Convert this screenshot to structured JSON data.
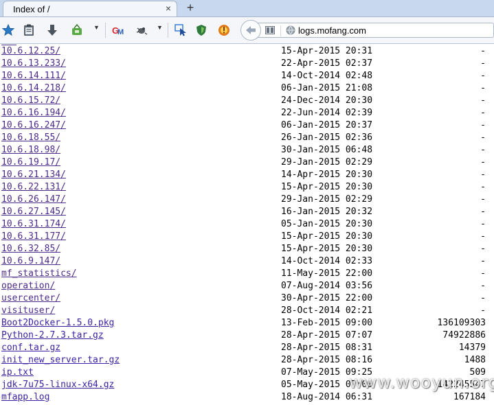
{
  "tab": {
    "title": "Index of /",
    "close": "×",
    "new_tab": "+"
  },
  "toolbar": {
    "icons": [
      "star-icon",
      "clipboard-icon",
      "download-arrow-icon",
      "basket-icon",
      "gm-icon",
      "bug-icon",
      "cursor-icon",
      "shield-icon",
      "addon-icon"
    ]
  },
  "url": {
    "text": "logs.mofang.com"
  },
  "listing": {
    "rows": [
      {
        "name": "10.6.12.25/",
        "date": "15-Apr-2015 20:31",
        "size": "-",
        "dir": true
      },
      {
        "name": "10.6.13.233/",
        "date": "22-Apr-2015 02:37",
        "size": "-",
        "dir": true
      },
      {
        "name": "10.6.14.111/",
        "date": "14-Oct-2014 02:48",
        "size": "-",
        "dir": true
      },
      {
        "name": "10.6.14.218/",
        "date": "06-Jan-2015 21:08",
        "size": "-",
        "dir": true
      },
      {
        "name": "10.6.15.72/",
        "date": "24-Dec-2014 20:30",
        "size": "-",
        "dir": true
      },
      {
        "name": "10.6.16.194/",
        "date": "22-Jun-2014 02:39",
        "size": "-",
        "dir": true
      },
      {
        "name": "10.6.16.247/",
        "date": "06-Jan-2015 20:37",
        "size": "-",
        "dir": true
      },
      {
        "name": "10.6.18.55/",
        "date": "26-Jan-2015 02:36",
        "size": "-",
        "dir": true
      },
      {
        "name": "10.6.18.98/",
        "date": "30-Jan-2015 06:48",
        "size": "-",
        "dir": true
      },
      {
        "name": "10.6.19.17/",
        "date": "29-Jan-2015 02:29",
        "size": "-",
        "dir": true
      },
      {
        "name": "10.6.21.134/",
        "date": "14-Apr-2015 20:30",
        "size": "-",
        "dir": true
      },
      {
        "name": "10.6.22.131/",
        "date": "15-Apr-2015 20:30",
        "size": "-",
        "dir": true
      },
      {
        "name": "10.6.26.147/",
        "date": "29-Jan-2015 02:29",
        "size": "-",
        "dir": true
      },
      {
        "name": "10.6.27.145/",
        "date": "16-Jan-2015 20:32",
        "size": "-",
        "dir": true
      },
      {
        "name": "10.6.31.174/",
        "date": "05-Jan-2015 20:30",
        "size": "-",
        "dir": true
      },
      {
        "name": "10.6.31.177/",
        "date": "15-Apr-2015 20:30",
        "size": "-",
        "dir": true
      },
      {
        "name": "10.6.32.85/",
        "date": "15-Apr-2015 20:30",
        "size": "-",
        "dir": true
      },
      {
        "name": "10.6.9.147/",
        "date": "14-Oct-2014 02:33",
        "size": "-",
        "dir": true
      },
      {
        "name": "mf_statistics/",
        "date": "11-May-2015 22:00",
        "size": "-",
        "dir": true
      },
      {
        "name": "operation/",
        "date": "07-Aug-2014 03:56",
        "size": "-",
        "dir": true
      },
      {
        "name": "usercenter/",
        "date": "30-Apr-2015 22:00",
        "size": "-",
        "dir": true
      },
      {
        "name": "visituser/",
        "date": "28-Oct-2014 02:21",
        "size": "-",
        "dir": true
      },
      {
        "name": "Boot2Docker-1.5.0.pkg",
        "date": "13-Feb-2015 09:00",
        "size": "136109303",
        "dir": false
      },
      {
        "name": "Python-2.7.3.tar.gz",
        "date": "28-Apr-2015 07:07",
        "size": "74922886",
        "dir": false
      },
      {
        "name": "conf.tar.gz",
        "date": "28-Apr-2015 08:31",
        "size": "14379",
        "dir": false
      },
      {
        "name": "init_new_server.tar.gz",
        "date": "28-Apr-2015 08:16",
        "size": "1488",
        "dir": false
      },
      {
        "name": "ip.txt",
        "date": "07-May-2015 09:25",
        "size": "509",
        "dir": false
      },
      {
        "name": "jdk-7u75-linux-x64.gz",
        "date": "05-May-2015 07:00",
        "size": "142245547",
        "dir": false
      },
      {
        "name": "mfapp.log",
        "date": "18-Aug-2014 06:31",
        "size": "167184",
        "dir": false
      }
    ]
  },
  "watermark": {
    "text": "www.wooyun.org"
  }
}
